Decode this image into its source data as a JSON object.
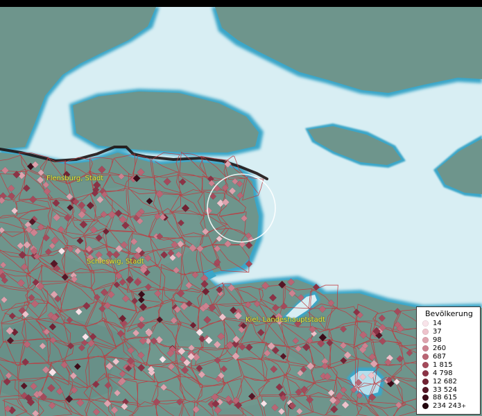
{
  "cities": [
    {
      "name": "Flensburg, Stadt"
    },
    {
      "name": "Schleswig, Stadt"
    },
    {
      "name": "Kiel, Landeshauptstadt"
    }
  ],
  "legend": {
    "title": "Bevölkerung",
    "items": [
      {
        "label": "14",
        "color": "#f9e4ea"
      },
      {
        "label": "37",
        "color": "#eec3cc"
      },
      {
        "label": "98",
        "color": "#dea3ae"
      },
      {
        "label": "260",
        "color": "#cd8290"
      },
      {
        "label": "687",
        "color": "#b96574"
      },
      {
        "label": "1 815",
        "color": "#a44a5b"
      },
      {
        "label": "4 798",
        "color": "#8b3346"
      },
      {
        "label": "12 682",
        "color": "#712233"
      },
      {
        "label": "33 524",
        "color": "#561626"
      },
      {
        "label": "88 615",
        "color": "#3c0c19"
      },
      {
        "label": "234 243",
        "color": "#22050d"
      }
    ],
    "overflow_marker": "+"
  },
  "colors": {
    "water": "#d8eef3",
    "shore_blue": "#3aa6c8",
    "land": "#6e958c",
    "land_far": "#5e7f76",
    "boundary": "#c1393f",
    "border_line": "#1e1414"
  }
}
